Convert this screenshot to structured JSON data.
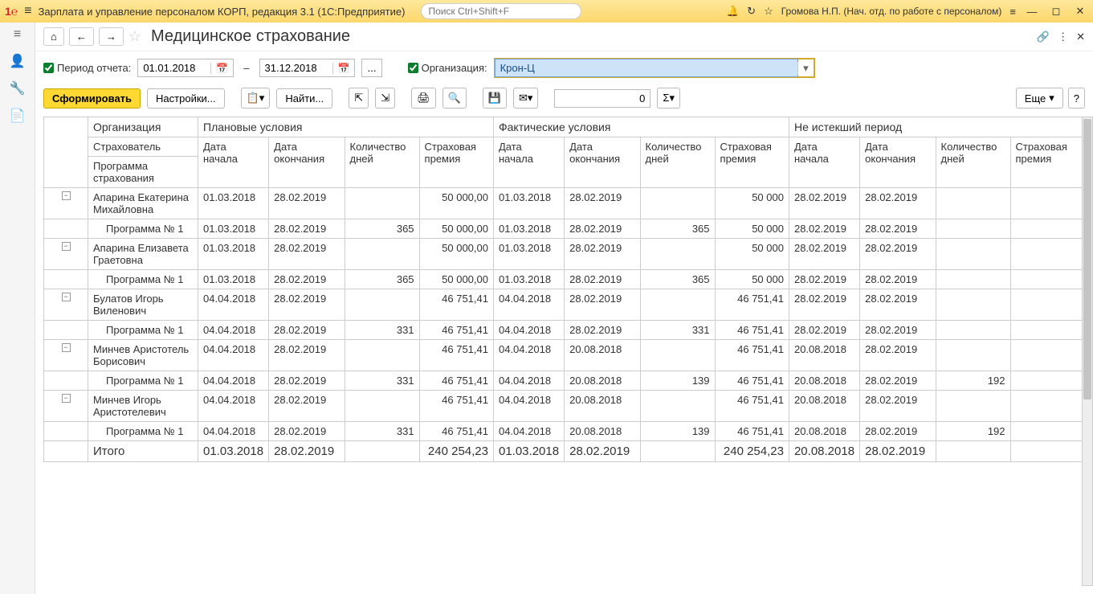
{
  "titlebar": {
    "app_title": "Зарплата и управление персоналом КОРП, редакция 3.1  (1С:Предприятие)",
    "search_placeholder": "Поиск Ctrl+Shift+F",
    "user": "Громова Н.П. (Нач. отд. по работе с персоналом)"
  },
  "page": {
    "title": "Медицинское страхование"
  },
  "filters": {
    "period_label": "Период отчета:",
    "date_from": "01.01.2018",
    "date_to": "31.12.2018",
    "org_label": "Организация:",
    "org_value": "Крон-Ц"
  },
  "toolbar": {
    "form": "Сформировать",
    "settings": "Настройки...",
    "find": "Найти...",
    "num_value": "0",
    "more": "Еще"
  },
  "table": {
    "headers": {
      "org": "Организация",
      "insurer": "Страхователь",
      "program": "Программа страхования",
      "plan_group": "Плановые условия",
      "fact_group": "Фактические условия",
      "remain_group": "Не истекший период",
      "start": "Дата начала",
      "end": "Дата окончания",
      "days": "Количество дней",
      "premium": "Страховая премия"
    },
    "rows": [
      {
        "type": "person",
        "tree": "-",
        "name": "Апарина Екатерина Михайловна",
        "p_start": "01.03.2018",
        "p_end": "28.02.2019",
        "p_days": "",
        "p_prem": "50 000,00",
        "f_start": "01.03.2018",
        "f_end": "28.02.2019",
        "f_days": "",
        "f_prem": "50 000",
        "r_start": "28.02.2019",
        "r_end": "28.02.2019",
        "r_days": "",
        "r_prem": ""
      },
      {
        "type": "prog",
        "name": "Программа № 1",
        "p_start": "01.03.2018",
        "p_end": "28.02.2019",
        "p_days": "365",
        "p_prem": "50 000,00",
        "f_start": "01.03.2018",
        "f_end": "28.02.2019",
        "f_days": "365",
        "f_prem": "50 000",
        "r_start": "28.02.2019",
        "r_end": "28.02.2019",
        "r_days": "",
        "r_prem": ""
      },
      {
        "type": "person",
        "tree": "-",
        "name": "Апарина Елизавета Граетовна",
        "p_start": "01.03.2018",
        "p_end": "28.02.2019",
        "p_days": "",
        "p_prem": "50 000,00",
        "f_start": "01.03.2018",
        "f_end": "28.02.2019",
        "f_days": "",
        "f_prem": "50 000",
        "r_start": "28.02.2019",
        "r_end": "28.02.2019",
        "r_days": "",
        "r_prem": ""
      },
      {
        "type": "prog",
        "name": "Программа № 1",
        "p_start": "01.03.2018",
        "p_end": "28.02.2019",
        "p_days": "365",
        "p_prem": "50 000,00",
        "f_start": "01.03.2018",
        "f_end": "28.02.2019",
        "f_days": "365",
        "f_prem": "50 000",
        "r_start": "28.02.2019",
        "r_end": "28.02.2019",
        "r_days": "",
        "r_prem": ""
      },
      {
        "type": "person",
        "tree": "-",
        "name": "Булатов Игорь Виленович",
        "p_start": "04.04.2018",
        "p_end": "28.02.2019",
        "p_days": "",
        "p_prem": "46 751,41",
        "f_start": "04.04.2018",
        "f_end": "28.02.2019",
        "f_days": "",
        "f_prem": "46 751,41",
        "r_start": "28.02.2019",
        "r_end": "28.02.2019",
        "r_days": "",
        "r_prem": ""
      },
      {
        "type": "prog",
        "name": "Программа № 1",
        "p_start": "04.04.2018",
        "p_end": "28.02.2019",
        "p_days": "331",
        "p_prem": "46 751,41",
        "f_start": "04.04.2018",
        "f_end": "28.02.2019",
        "f_days": "331",
        "f_prem": "46 751,41",
        "r_start": "28.02.2019",
        "r_end": "28.02.2019",
        "r_days": "",
        "r_prem": ""
      },
      {
        "type": "person",
        "tree": "-",
        "name": "Минчев Аристотель Борисович",
        "p_start": "04.04.2018",
        "p_end": "28.02.2019",
        "p_days": "",
        "p_prem": "46 751,41",
        "f_start": "04.04.2018",
        "f_end": "20.08.2018",
        "f_days": "",
        "f_prem": "46 751,41",
        "r_start": "20.08.2018",
        "r_end": "28.02.2019",
        "r_days": "",
        "r_prem": ""
      },
      {
        "type": "prog",
        "name": "Программа № 1",
        "p_start": "04.04.2018",
        "p_end": "28.02.2019",
        "p_days": "331",
        "p_prem": "46 751,41",
        "f_start": "04.04.2018",
        "f_end": "20.08.2018",
        "f_days": "139",
        "f_prem": "46 751,41",
        "r_start": "20.08.2018",
        "r_end": "28.02.2019",
        "r_days": "192",
        "r_prem": ""
      },
      {
        "type": "person",
        "tree": "-",
        "name": "Минчев Игорь Аристотелевич",
        "p_start": "04.04.2018",
        "p_end": "28.02.2019",
        "p_days": "",
        "p_prem": "46 751,41",
        "f_start": "04.04.2018",
        "f_end": "20.08.2018",
        "f_days": "",
        "f_prem": "46 751,41",
        "r_start": "20.08.2018",
        "r_end": "28.02.2019",
        "r_days": "",
        "r_prem": ""
      },
      {
        "type": "prog",
        "name": "Программа № 1",
        "p_start": "04.04.2018",
        "p_end": "28.02.2019",
        "p_days": "331",
        "p_prem": "46 751,41",
        "f_start": "04.04.2018",
        "f_end": "20.08.2018",
        "f_days": "139",
        "f_prem": "46 751,41",
        "r_start": "20.08.2018",
        "r_end": "28.02.2019",
        "r_days": "192",
        "r_prem": ""
      }
    ],
    "total": {
      "label": "Итого",
      "p_start": "01.03.2018",
      "p_end": "28.02.2019",
      "p_days": "",
      "p_prem": "240 254,23",
      "f_start": "01.03.2018",
      "f_end": "28.02.2019",
      "f_days": "",
      "f_prem": "240 254,23",
      "r_start": "20.08.2018",
      "r_end": "28.02.2019",
      "r_days": "",
      "r_prem": ""
    }
  }
}
